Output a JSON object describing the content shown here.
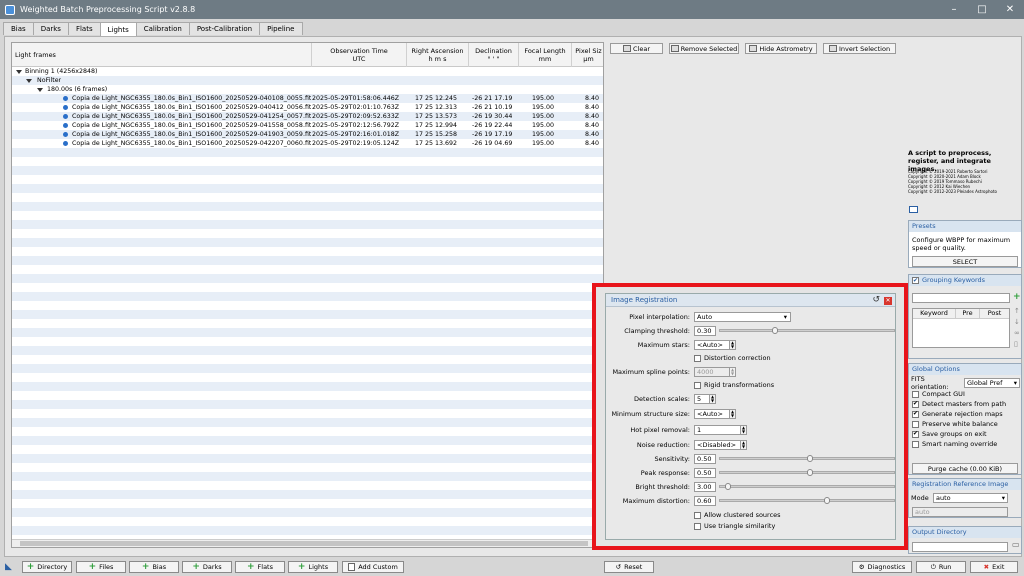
{
  "window": {
    "title": "Weighted Batch Preprocessing Script v2.8.8",
    "controls": [
      "–",
      "□",
      "✕"
    ]
  },
  "tabs": [
    "Bias",
    "Darks",
    "Flats",
    "Lights",
    "Calibration",
    "Post-Calibration",
    "Pipeline"
  ],
  "active_tab": "Lights",
  "table": {
    "headers": {
      "name": "Light frames",
      "obs1": "Observation Time",
      "obs2": "UTC",
      "ra1": "Right Ascension",
      "ra2": "h   m   s",
      "dec1": "Declination",
      "dec2": "°   '   \"",
      "fl1": "Focal Length",
      "fl2": "mm",
      "ps1": "Pixel Siz",
      "ps2": "μm"
    },
    "tree": [
      "Binning 1 (4256x2848)",
      "NoFilter",
      "180.00s (6 frames)"
    ],
    "rows": [
      {
        "name": "Copia de Light_NGC6355_180.0s_Bin1_ISO1600_20250529-040108_0055.fit",
        "time": "2025-05-29T01:58:06.446Z",
        "ra": "17 25 12.245",
        "dec": "-26 21 17.19",
        "fl": "195.00",
        "ps": "8.40"
      },
      {
        "name": "Copia de Light_NGC6355_180.0s_Bin1_ISO1600_20250529-040412_0056.fit",
        "time": "2025-05-29T02:01:10.763Z",
        "ra": "17 25 12.313",
        "dec": "-26 21 10.19",
        "fl": "195.00",
        "ps": "8.40"
      },
      {
        "name": "Copia de Light_NGC6355_180.0s_Bin1_ISO1600_20250529-041254_0057.fit",
        "time": "2025-05-29T02:09:52.633Z",
        "ra": "17 25 13.573",
        "dec": "-26 19 30.44",
        "fl": "195.00",
        "ps": "8.40"
      },
      {
        "name": "Copia de Light_NGC6355_180.0s_Bin1_ISO1600_20250529-041558_0058.fit",
        "time": "2025-05-29T02:12:56.792Z",
        "ra": "17 25 12.994",
        "dec": "-26 19 22.44",
        "fl": "195.00",
        "ps": "8.40"
      },
      {
        "name": "Copia de Light_NGC6355_180.0s_Bin1_ISO1600_20250529-041903_0059.fit",
        "time": "2025-05-29T02:16:01.018Z",
        "ra": "17 25 15.258",
        "dec": "-26 19 17.19",
        "fl": "195.00",
        "ps": "8.40"
      },
      {
        "name": "Copia de Light_NGC6355_180.0s_Bin1_ISO1600_20250529-042207_0060.fit",
        "time": "2025-05-29T02:19:05.124Z",
        "ra": "17 25 13.692",
        "dec": "-26 19 04.69",
        "fl": "195.00",
        "ps": "8.40"
      }
    ]
  },
  "actions": {
    "clear": "Clear",
    "remove": "Remove Selected",
    "hide": "Hide Astrometry",
    "invert": "Invert Selection"
  },
  "about": {
    "title": "A script to preprocess, register, and integrate images.",
    "copyright": [
      "Copyright © 2019-2021 Roberto Sartori",
      "Copyright © 2020-2021 Adam Block",
      "Copyright © 2019 Tommaso Rubechi",
      "Copyright © 2012 Kai Wiechen",
      "Copyright © 2012-2023 Pleiades Astrophoto"
    ]
  },
  "presets": {
    "header": "Presets",
    "desc": "Configure WBPP for maximum speed or quality.",
    "select": "SELECT"
  },
  "grouping": {
    "header": "Grouping Keywords",
    "cols": [
      "Keyword",
      "Pre",
      "Post"
    ]
  },
  "global": {
    "header": "Global Options",
    "fits_label": "FITS orientation:",
    "fits_value": "Global Pref",
    "options": [
      {
        "label": "Compact GUI",
        "checked": false
      },
      {
        "label": "Detect masters from path",
        "checked": true
      },
      {
        "label": "Generate rejection maps",
        "checked": true
      },
      {
        "label": "Preserve white balance",
        "checked": false
      },
      {
        "label": "Save groups on exit",
        "checked": true
      },
      {
        "label": "Smart naming override",
        "checked": false
      }
    ],
    "purge": "Purge cache (0.00 KiB)"
  },
  "reference": {
    "header": "Registration Reference Image",
    "mode_label": "Mode",
    "mode_value": "auto",
    "field": "auto"
  },
  "output": {
    "header": "Output Directory"
  },
  "registration": {
    "header": "Image Registration",
    "pixel_interp_label": "Pixel interpolation:",
    "pixel_interp": "Auto",
    "clamping_label": "Clamping threshold:",
    "clamping": "0.30",
    "max_stars_label": "Maximum stars:",
    "max_stars": "<Auto>",
    "distortion": "Distortion correction",
    "spline_label": "Maximum spline points:",
    "spline": "4000",
    "rigid": "Rigid transformations",
    "detection_label": "Detection scales:",
    "detection": "5",
    "min_struct_label": "Minimum structure size:",
    "min_struct": "<Auto>",
    "hot_pixel_label": "Hot pixel removal:",
    "hot_pixel": "1",
    "noise_label": "Noise reduction:",
    "noise": "<Disabled>",
    "sensitivity_label": "Sensitivity:",
    "sensitivity": "0.50",
    "peak_label": "Peak response:",
    "peak": "0.50",
    "bright_label": "Bright threshold:",
    "bright": "3.00",
    "maxdist_label": "Maximum distortion:",
    "maxdist": "0.60",
    "clustered": "Allow clustered sources",
    "triangle": "Use triangle similarity",
    "slider_levels": {
      "clamping": 0.3,
      "sensitivity": 0.5,
      "peak": 0.5,
      "bright": 0.03,
      "maxdist": 0.6
    }
  },
  "bottom": {
    "directory": "Directory",
    "files": "Files",
    "bias": "Bias",
    "darks": "Darks",
    "flats": "Flats",
    "lights": "Lights",
    "add_custom": "Add Custom",
    "reset": "Reset",
    "diagnostics": "Diagnostics",
    "run": "Run",
    "exit": "Exit"
  },
  "colors": {
    "highlight": "#e8141b",
    "accent": "#2a5fa3"
  }
}
